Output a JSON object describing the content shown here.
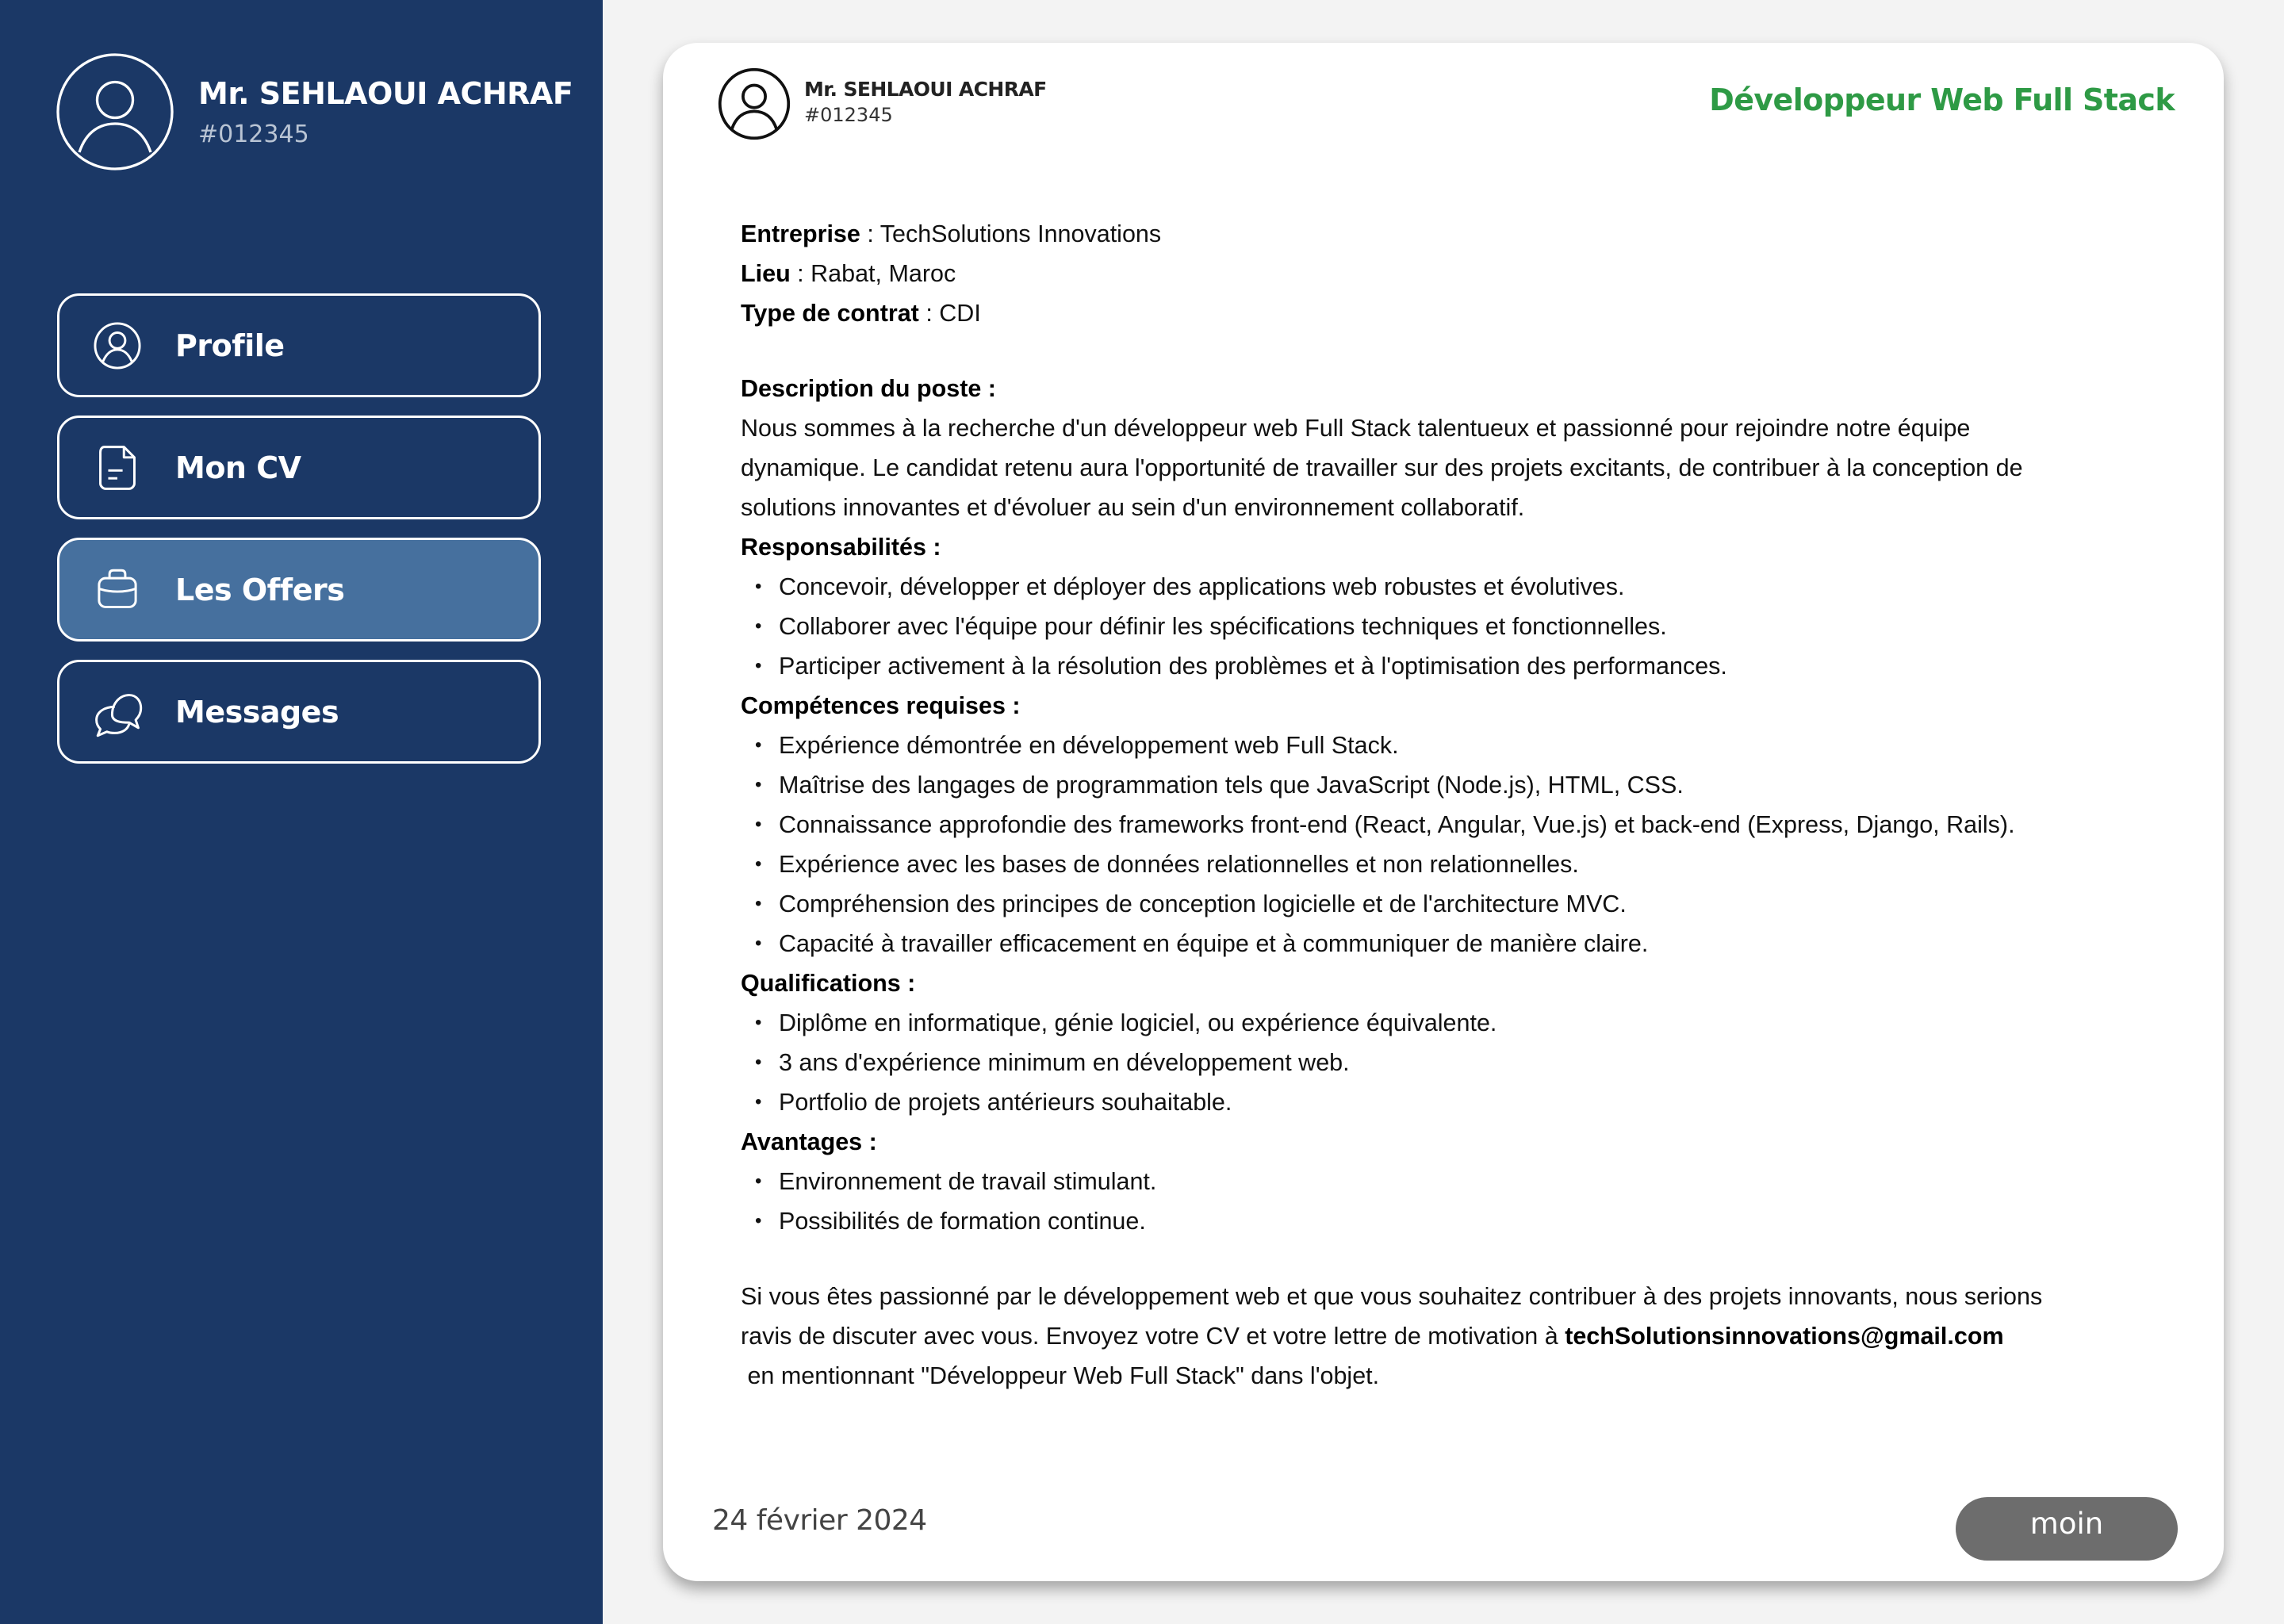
{
  "sidebar": {
    "user": {
      "name": "Mr. SEHLAOUI ACHRAF",
      "id": "#012345",
      "avatar_icon": "user-avatar-icon"
    },
    "nav": [
      {
        "label": "Profile",
        "icon": "user-circle-icon",
        "active": false
      },
      {
        "label": "Mon CV",
        "icon": "document-icon",
        "active": false
      },
      {
        "label": "Les Offers",
        "icon": "briefcase-icon",
        "active": true
      },
      {
        "label": "Messages",
        "icon": "chat-bubbles-icon",
        "active": false
      }
    ],
    "colors": {
      "background": "#1b3866",
      "active_item": "#46709e"
    }
  },
  "offer": {
    "author": {
      "name": "Mr. SEHLAOUI ACHRAF",
      "id": "#012345"
    },
    "title": "Développeur Web Full Stack",
    "title_color": "#2e9a45",
    "meta": {
      "entreprise_label": "Entreprise",
      "entreprise_value": "TechSolutions Innovations",
      "lieu_label": "Lieu",
      "lieu_value": "Rabat, Maroc",
      "contrat_label": "Type de contrat",
      "contrat_value": "CDI"
    },
    "description": {
      "heading": "Description du poste :",
      "lines": [
        "Nous sommes à la recherche d'un développeur web Full Stack talentueux et passionné pour rejoindre notre équipe",
        "dynamique. Le candidat retenu aura l'opportunité de travailler sur des projets excitants, de contribuer à la conception de",
        "solutions innovantes et d'évoluer au sein d'un environnement collaboratif."
      ]
    },
    "responsabilites": {
      "heading": "Responsabilités :",
      "items": [
        "Concevoir, développer et déployer des applications web robustes et évolutives.",
        "Collaborer avec l'équipe pour définir les spécifications techniques et fonctionnelles.",
        "Participer activement à la résolution des problèmes et à l'optimisation des performances."
      ]
    },
    "competences": {
      "heading": "Compétences requises :",
      "items": [
        "Expérience démontrée en développement web Full Stack.",
        "Maîtrise des langages de programmation tels que JavaScript (Node.js), HTML, CSS.",
        "Connaissance approfondie des frameworks front-end (React, Angular, Vue.js) et back-end (Express, Django, Rails).",
        "Expérience avec les bases de données relationnelles et non relationnelles.",
        "Compréhension des principes de conception logicielle et de l'architecture MVC.",
        "Capacité à travailler efficacement en équipe et à communiquer de manière claire."
      ]
    },
    "qualifications": {
      "heading": "Qualifications :",
      "items": [
        "Diplôme en informatique, génie logiciel, ou expérience équivalente.",
        "3 ans d'expérience minimum en développement web.",
        "Portfolio de projets antérieurs souhaitable."
      ]
    },
    "avantages": {
      "heading": "Avantages :",
      "items": [
        "Environnement de travail stimulant.",
        "Possibilités de formation continue."
      ]
    },
    "closing": {
      "line1": "Si vous êtes passionné par le développement web et que vous souhaitez contribuer à des projets innovants, nous serions",
      "line2_prefix": "ravis de discuter avec vous. Envoyez votre CV et votre lettre de motivation à ",
      "email": "techSolutionsinnovations@gmail.com",
      "line3": " en mentionnant \"Développeur Web Full Stack\" dans l'objet."
    },
    "date": "24 février 2024",
    "less_button_label": "moin"
  }
}
